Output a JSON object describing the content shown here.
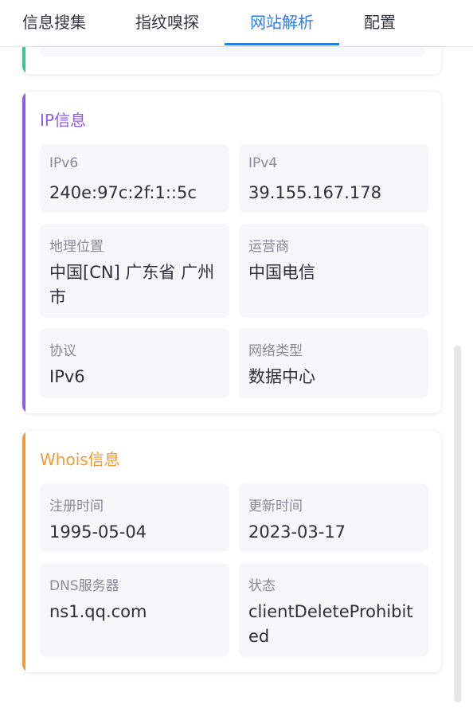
{
  "tabs": [
    {
      "label": "信息搜集"
    },
    {
      "label": "指纹嗅探"
    },
    {
      "label": "网站解析"
    },
    {
      "label": "配置"
    }
  ],
  "active_tab": "网站解析",
  "colors": {
    "tab_active": "#2e7de2",
    "ip_accent": "#8a5cf0",
    "whois_accent": "#f29a38",
    "top_accent": "#35c995"
  },
  "ip_section": {
    "title": "IP信息",
    "fields": [
      {
        "label": "IPv6",
        "value": "240e:97c:2f:1::5c"
      },
      {
        "label": "IPv4",
        "value": "39.155.167.178"
      },
      {
        "label": "地理位置",
        "value": "中国[CN] 广东省 广州市"
      },
      {
        "label": "运营商",
        "value": "中国电信"
      },
      {
        "label": "协议",
        "value": "IPv6"
      },
      {
        "label": "网络类型",
        "value": "数据中心"
      }
    ]
  },
  "whois_section": {
    "title": "Whois信息",
    "fields": [
      {
        "label": "注册时间",
        "value": "1995-05-04"
      },
      {
        "label": "更新时间",
        "value": "2023-03-17"
      },
      {
        "label": "DNS服务器",
        "value": "ns1.qq.com"
      },
      {
        "label": "状态",
        "value": "clientDeleteProhibited"
      }
    ]
  }
}
